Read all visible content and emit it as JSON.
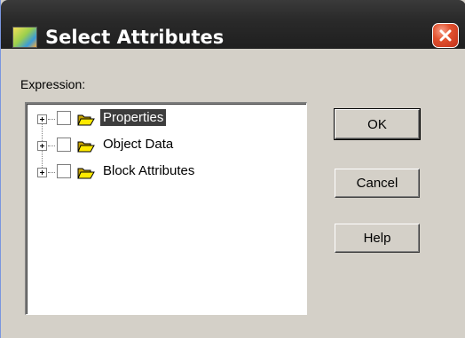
{
  "window": {
    "title": "Select Attributes",
    "colors": {
      "titlebar": "#2a2a2a",
      "face": "#d4d0c8",
      "close": "#e2522f"
    }
  },
  "expression": {
    "label": "Expression:"
  },
  "tree": {
    "items": [
      {
        "label": "Properties",
        "checked": false,
        "expanded": false,
        "selected": true
      },
      {
        "label": "Object Data",
        "checked": false,
        "expanded": false,
        "selected": false
      },
      {
        "label": "Block Attributes",
        "checked": false,
        "expanded": false,
        "selected": false
      }
    ]
  },
  "buttons": {
    "ok": "OK",
    "cancel": "Cancel",
    "help": "Help"
  },
  "icons": {
    "app": "app-icon",
    "close": "close-icon",
    "folder": "folder-open-icon",
    "expander": "plus-expander-icon"
  }
}
